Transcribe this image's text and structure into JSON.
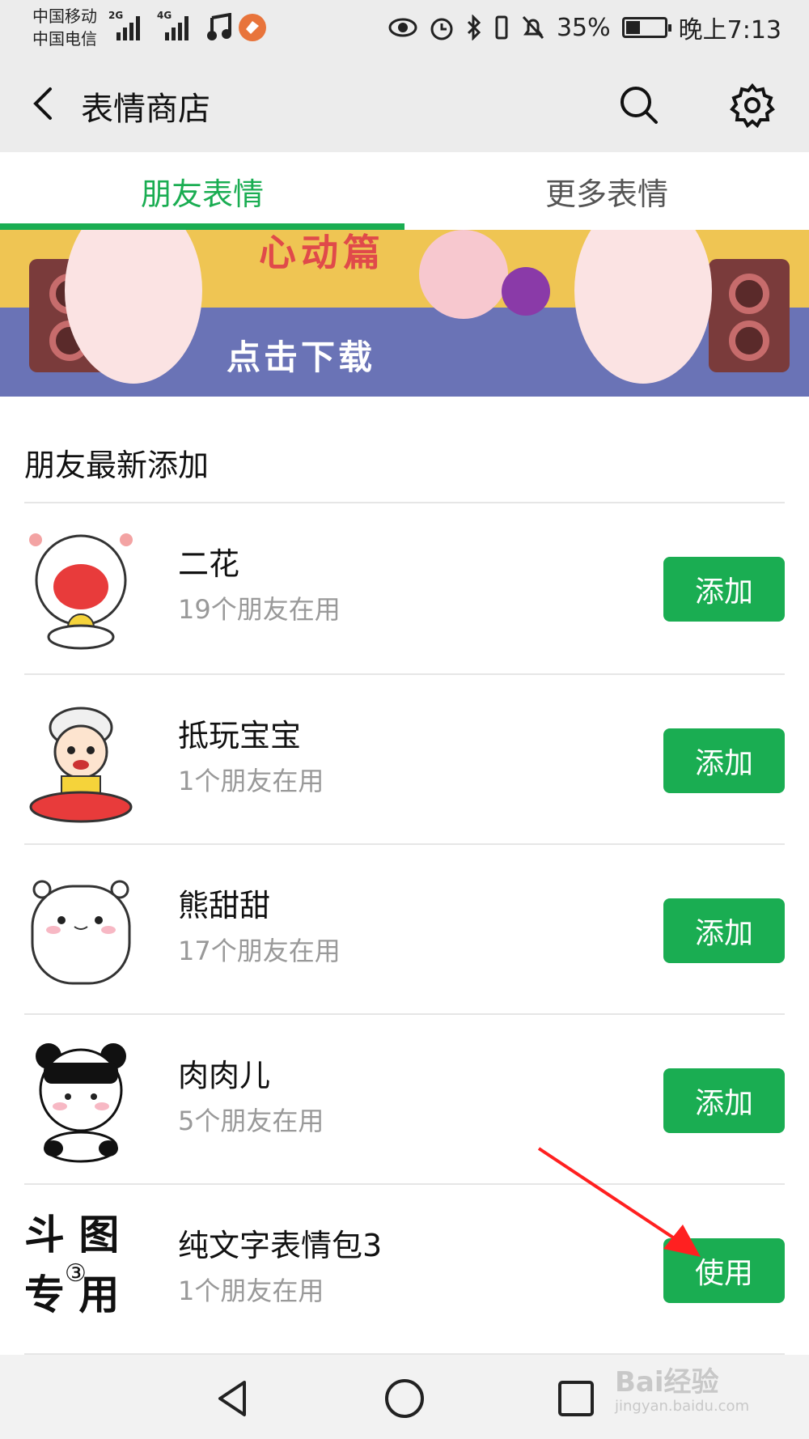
{
  "status_bar": {
    "carrier1": "中国移动",
    "carrier2": "中国电信",
    "net1": "2G",
    "net2": "4G",
    "battery": "35%",
    "time": "晚上7:13",
    "icons": [
      "signal-icon",
      "music-icon",
      "app-notification-icon",
      "eye-icon",
      "alarm-icon",
      "bluetooth-icon",
      "vibrate-icon",
      "mute-icon",
      "battery-icon"
    ]
  },
  "header": {
    "title": "表情商店",
    "icons": [
      "back-arrow-icon",
      "search-icon",
      "gear-icon"
    ]
  },
  "tabs": [
    {
      "label": "朋友表情",
      "active": true
    },
    {
      "label": "更多表情",
      "active": false
    }
  ],
  "banner": {
    "headline": "心动篇",
    "action": "点击下载"
  },
  "section": {
    "title": "朋友最新添加"
  },
  "items": [
    {
      "name": "二花",
      "users": "19个朋友在用",
      "button": "添加"
    },
    {
      "name": "抵玩宝宝",
      "users": "1个朋友在用",
      "button": "添加"
    },
    {
      "name": "熊甜甜",
      "users": "17个朋友在用",
      "button": "添加"
    },
    {
      "name": "肉肉儿",
      "users": "5个朋友在用",
      "button": "添加"
    },
    {
      "name": "纯文字表情包3",
      "users": "1个朋友在用",
      "button": "使用"
    }
  ],
  "text_pack_thumb": {
    "line1": "斗 图",
    "line2": "专 用",
    "badge": "③"
  },
  "watermark": {
    "brand": "Bai经验",
    "url": "jingyan.baidu.com"
  },
  "colors": {
    "accent": "#1aad52",
    "header_bg": "#ececec",
    "annotation": "#ff2020"
  }
}
